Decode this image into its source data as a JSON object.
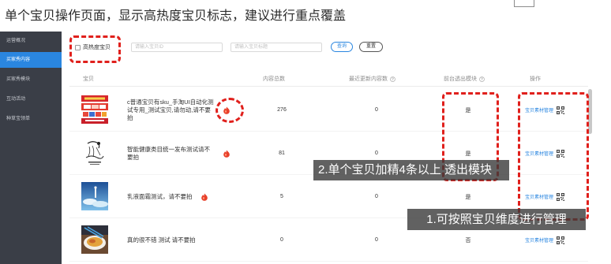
{
  "page": {
    "heading": "单个宝贝操作页面，显示高热度宝贝标志，建议进行重点覆盖"
  },
  "sidebar": {
    "items": [
      {
        "label": "运营概况",
        "active": false
      },
      {
        "label": "买家秀内容",
        "active": true
      },
      {
        "label": "买家秀模块",
        "active": false
      },
      {
        "label": "互动活动",
        "active": false
      },
      {
        "label": "种草宝领单",
        "active": false
      }
    ]
  },
  "filters": {
    "hot_item_label": "高热度宝贝",
    "hot_item_checked": false,
    "item_id_placeholder": "请输入宝贝ID",
    "item_title_placeholder": "请输入宝贝标题",
    "search_label": "查询",
    "reset_label": "重置"
  },
  "table": {
    "headers": {
      "item": "宝贝",
      "content_total": "内容总数",
      "recent_updates": "最近更新内容数",
      "front_module": "前台透出模块",
      "actions": "操作"
    },
    "rows": [
      {
        "title": "c普通宝贝有sku_手淘UI自动化测试专用_测试宝贝,请勿动,请不要拍",
        "hot": true,
        "content_total": "276",
        "recent_updates": "0",
        "front_module": "是",
        "action_label": "宝贝素材管理"
      },
      {
        "title": "智能健康类目统一发布测试请不要拍",
        "hot": true,
        "content_total": "81",
        "recent_updates": "0",
        "front_module": "是",
        "action_label": "宝贝素材管理"
      },
      {
        "title": "乳液面霜测试，请不要拍",
        "hot": true,
        "content_total": "5",
        "recent_updates": "0",
        "front_module": "是",
        "action_label": "宝贝素材管理"
      },
      {
        "title": "真的很不错 测试 请不要拍",
        "hot": false,
        "content_total": "0",
        "recent_updates": "0",
        "front_module": "否",
        "action_label": "宝贝素材管理"
      }
    ]
  },
  "annotations": {
    "note_manage": "1.可按照宝贝维度进行管理",
    "note_module": "2.单个宝贝加精4条以上 透出模块"
  },
  "icons": {
    "hot": "hot-flame-icon",
    "info": "info-icon",
    "qrcode": "qrcode-icon",
    "checkbox": "checkbox-icon"
  },
  "colors": {
    "accent": "#2a86e0",
    "sidebar_bg": "#3a3e47",
    "annotation_red": "#e0201c"
  }
}
